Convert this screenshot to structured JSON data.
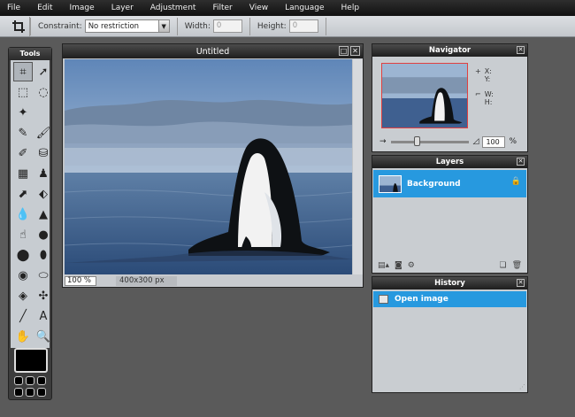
{
  "menu": [
    "File",
    "Edit",
    "Image",
    "Layer",
    "Adjustment",
    "Filter",
    "View",
    "Language",
    "Help"
  ],
  "options": {
    "constraint_label": "Constraint:",
    "constraint_value": "No restriction",
    "width_label": "Width:",
    "width_value": "0",
    "height_label": "Height:",
    "height_value": "0"
  },
  "tools": {
    "title": "Tools",
    "icons": [
      "crop-icon",
      "move-icon",
      "marquee-icon",
      "lasso-icon",
      "wand-icon",
      "blank",
      "pencil-icon",
      "brush-icon",
      "eraser-icon",
      "bucket-icon",
      "gradient-icon",
      "clone-stamp-icon",
      "color-replace-icon",
      "drawing-icon",
      "blur-icon",
      "sharpen-icon",
      "smudge-icon",
      "sponge-icon",
      "burn-icon",
      "dodge-icon",
      "red-eye-icon",
      "spot-heal-icon",
      "bloat-icon",
      "pinch-icon",
      "color-picker-icon",
      "text-icon",
      "hand-icon",
      "zoom-icon"
    ],
    "glyphs": [
      "⌗",
      "➚",
      "⬚",
      "◌",
      "✦",
      "",
      "✎",
      "🖌",
      "✐",
      "⛁",
      "▦",
      "♟",
      "⬈",
      "⬖",
      "💧",
      "▲",
      "☝",
      "●",
      "⬤",
      "⬮",
      "◉",
      "⬭",
      "◈",
      "✣",
      "╱",
      "A",
      "✋",
      "🔍"
    ],
    "foreground_color": "#000000"
  },
  "image_window": {
    "title": "Untitled",
    "zoom": "100 %",
    "dimensions": "400x300 px"
  },
  "navigator": {
    "title": "Navigator",
    "x_label": "X:",
    "y_label": "Y:",
    "w_label": "W:",
    "h_label": "H:",
    "zoom_value": "100",
    "zoom_unit": "%",
    "zoom_level": 0.33
  },
  "layers": {
    "title": "Layers",
    "items": [
      {
        "name": "Background",
        "locked": true
      }
    ]
  },
  "history": {
    "title": "History",
    "items": [
      {
        "name": "Open image"
      }
    ]
  },
  "colors": {
    "accent": "#2799df",
    "panel_bg": "#c9cdd1",
    "workspace": "#5a5a5a"
  }
}
